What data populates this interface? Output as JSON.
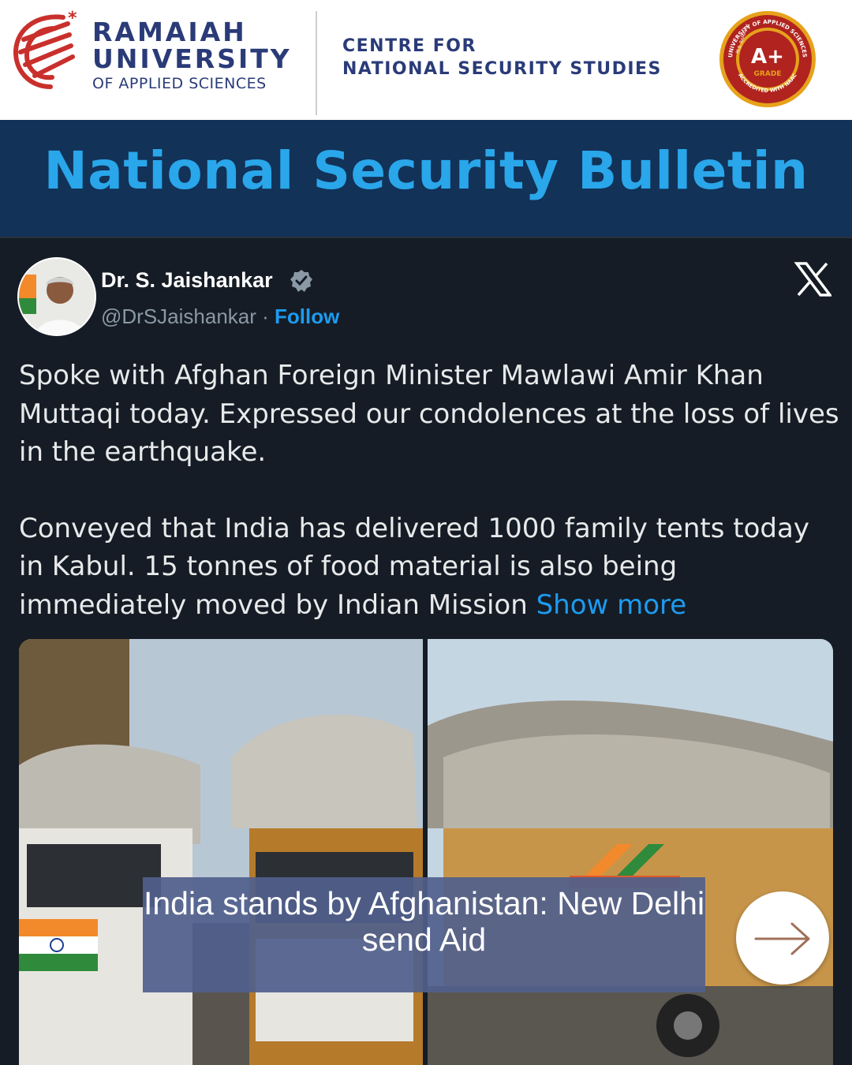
{
  "header": {
    "university": {
      "line1": "RAMAIAH",
      "line2": "UNIVERSITY",
      "line3": "OF APPLIED SCIENCES"
    },
    "centre": {
      "line1": "CENTRE FOR",
      "line2": "NATIONAL SECURITY STUDIES"
    },
    "seal": {
      "grade": "A+",
      "grade_label": "GRADE",
      "ring_text": "UNIVERSITY OF APPLIED SCIENCES",
      "ring_text_bottom": "ACCREDITED WITH NAAC",
      "ring_text_left": "M.S. RAMAIAH"
    }
  },
  "banner": {
    "title": "National Security Bulletin"
  },
  "tweet": {
    "author_name": "Dr. S. Jaishankar",
    "handle": "@DrSJaishankar",
    "separator": " · ",
    "follow_label": "Follow",
    "paragraph1": "Spoke with Afghan Foreign Minister Mawlawi Amir Khan Muttaqi today. Expressed our condolences at the loss of lives in the earthquake.",
    "paragraph2": "Conveyed that India has delivered 1000 family tents today in Kabul. 15 tonnes of food material is also being immediately moved by Indian Mission ",
    "show_more": "Show more"
  },
  "caption": {
    "text": "India stands by Afghanistan: New Delhi send Aid"
  },
  "icons": {
    "verified": "verified-badge-icon",
    "x_logo": "x-logo-icon",
    "next": "arrow-right-icon"
  },
  "colors": {
    "brand_navy": "#2a3b78",
    "banner_bg": "#123258",
    "banner_text": "#2aa6ea",
    "tweet_bg": "#151c25",
    "link_blue": "#1d9bf0",
    "logo_red": "#c9302c",
    "seal_gold": "#e6a21b"
  }
}
